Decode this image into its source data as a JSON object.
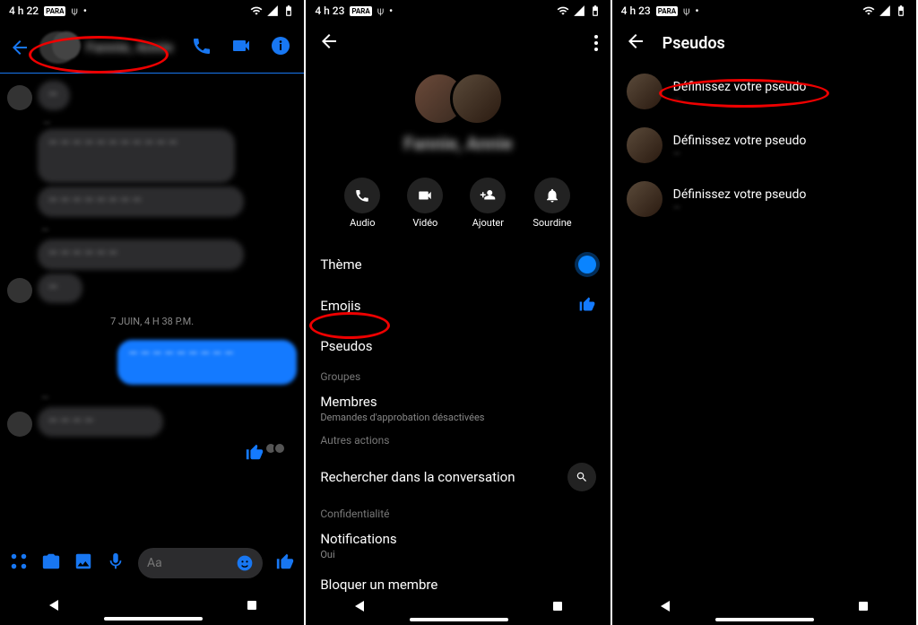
{
  "panel1": {
    "status": {
      "time": "4 h 22"
    },
    "header": {
      "title": "Fannie, Annie"
    },
    "messages": {
      "date_sep": "7 JUIN, 4 H 38 P.M.",
      "in1": "—",
      "sender2": "—",
      "in2a": "— — — — — — — — — — —",
      "in2b": "— — — — — — — —",
      "sender3": "—",
      "in3a": "— — — — — —",
      "in3b": "—",
      "out1": "— — — — — — — — —",
      "sender4": "—",
      "in4": "— — — —"
    },
    "input_placeholder": "Aa"
  },
  "panel2": {
    "status": {
      "time": "4 h 23"
    },
    "hero_name": "Fannie, Annie",
    "actions": {
      "audio": "Audio",
      "video": "Vidéo",
      "add": "Ajouter",
      "mute": "Sourdine"
    },
    "settings": {
      "theme": "Thème",
      "emojis": "Emojis",
      "nicknames": "Pseudos",
      "section_groups": "Groupes",
      "members": "Membres",
      "members_sub": "Demandes d'approbation désactivées",
      "section_other": "Autres actions",
      "search": "Rechercher dans la conversation",
      "section_privacy": "Confidentialité",
      "notifications": "Notifications",
      "notifications_sub": "Oui",
      "block": "Bloquer un membre"
    }
  },
  "panel3": {
    "status": {
      "time": "4 h 23"
    },
    "header_title": "Pseudos",
    "rows": {
      "label": "Définissez votre pseudo"
    }
  }
}
